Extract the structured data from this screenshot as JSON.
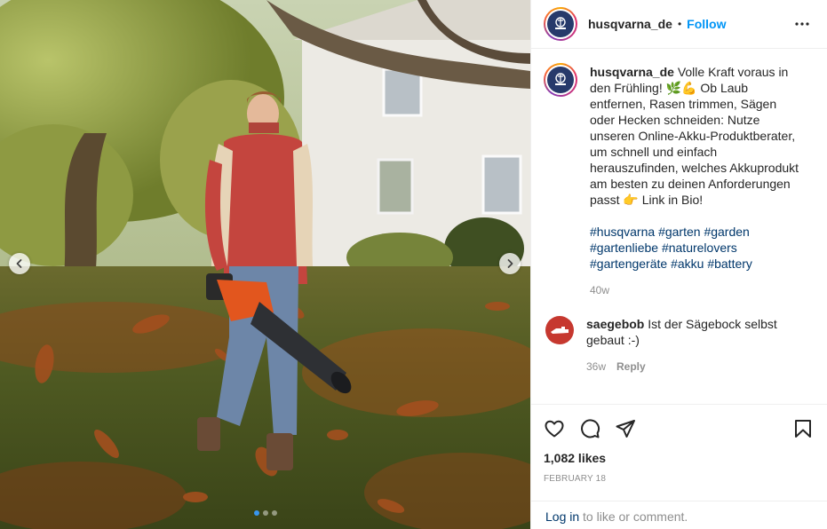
{
  "post": {
    "username": "husqvarna_de",
    "separator": "•",
    "follow_label": "Follow",
    "more_icon": "more-horizontal-icon"
  },
  "caption": {
    "username": "husqvarna_de",
    "text_before_emoji": "Volle Kraft voraus in den Frühling!",
    "emoji_1": "🌿",
    "emoji_2": "💪",
    "text_middle": "Ob Laub entfernen, Rasen trimmen, Sägen oder Hecken schneiden: Nutze unseren Online-Akku-Produktberater, um schnell und einfach herauszufinden, welches Akkuprodukt am besten zu deinen Anforderungen passt",
    "emoji_3": "👉",
    "text_after": "Link in Bio!",
    "hashtags": [
      "#husqvarna",
      "#garten",
      "#garden",
      "#gartenliebe",
      "#naturelovers",
      "#gartengeräte",
      "#akku",
      "#battery"
    ],
    "age": "40w"
  },
  "comment": {
    "username": "saegebob",
    "text": "Ist der Sägebock selbst gebaut :-)",
    "age": "36w",
    "reply_label": "Reply"
  },
  "stats": {
    "likes": "1,082 likes",
    "date": "FEBRUARY 18"
  },
  "login": {
    "link_label": "Log in",
    "rest_text": "to like or comment."
  },
  "carousel": {
    "slide_count": 3,
    "active_index": 1
  },
  "colors": {
    "follow": "#0095f6",
    "hashtag": "#00376b",
    "muted": "#8e8e8e",
    "brand_blue": "#273a6b",
    "active_dot": "#3897f0"
  }
}
